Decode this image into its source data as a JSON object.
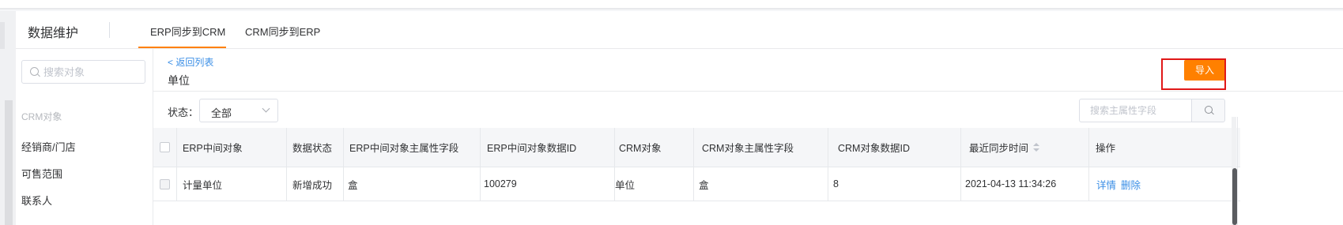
{
  "header": {
    "title": "数据维护",
    "tabs": [
      {
        "label": "ERP同步到CRM",
        "active": true
      },
      {
        "label": "CRM同步到ERP",
        "active": false
      }
    ]
  },
  "sidebar": {
    "search_placeholder": "搜索对象",
    "group_label": "CRM对象",
    "items": [
      "经销商/门店",
      "可售范围",
      "联系人"
    ]
  },
  "content": {
    "back_label": "< 返回列表",
    "page_title": "单位",
    "import_label": "导入",
    "status_label": "状态：",
    "status_value": "全部",
    "field_search_placeholder": "搜索主属性字段"
  },
  "table": {
    "columns": [
      "ERP中间对象",
      "数据状态",
      "ERP中间对象主属性字段",
      "ERP中间对象数据ID",
      "CRM对象",
      "CRM对象主属性字段",
      "CRM对象数据ID",
      "最近同步时间",
      "操作"
    ],
    "rows": [
      {
        "erp_object": "计量单位",
        "status": "新增成功",
        "erp_main_field": "盒",
        "erp_data_id": "100279",
        "crm_object": "单位",
        "crm_main_field": "盒",
        "crm_data_id": "8",
        "last_sync": "2021-04-13 11:34:26",
        "actions": [
          "详情",
          "删除"
        ]
      }
    ]
  },
  "colors": {
    "accent": "#ff8000",
    "link": "#3a8ee6",
    "highlight": "#e01818"
  }
}
